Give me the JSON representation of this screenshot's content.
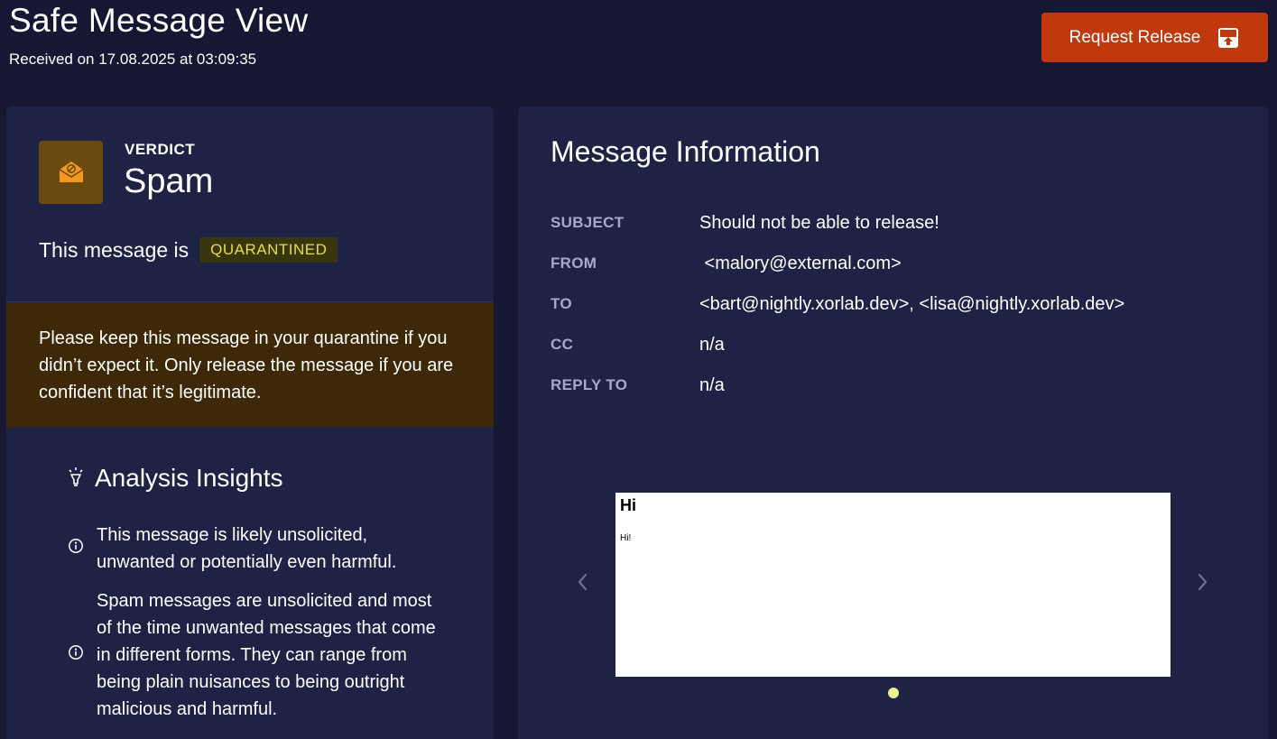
{
  "header": {
    "title": "Safe Message View",
    "received": "Received on 17.08.2025 at 03:09:35",
    "request_release_label": "Request Release"
  },
  "verdict": {
    "label": "VERDICT",
    "value": "Spam",
    "icon": "spam-envelope-icon",
    "status_prefix": "This message is",
    "status_badge": "QUARANTINED"
  },
  "warning": {
    "text": "Please keep this message in your quarantine if you didn’t expect it. Only release the message if you are confident that it’s legitimate."
  },
  "insights": {
    "title": "Analysis Insights",
    "items": [
      "This message is likely unsolicited, unwanted or potentially even harmful.",
      "Spam messages are unsolicited and most of the time unwanted messages that come in different forms. They can range from being plain nuisances to being outright malicious and harmful."
    ]
  },
  "message_info": {
    "title": "Message Information",
    "fields": [
      {
        "label": "SUBJECT",
        "value": "Should not be able to release!"
      },
      {
        "label": "FROM",
        "value": " <malory@external.com>"
      },
      {
        "label": "TO",
        "value": "<bart@nightly.xorlab.dev>, <lisa@nightly.xorlab.dev>"
      },
      {
        "label": "CC",
        "value": "n/a"
      },
      {
        "label": "REPLY TO",
        "value": "n/a"
      }
    ]
  },
  "preview": {
    "heading": "Hi",
    "body": "Hi!",
    "page_count": 1,
    "current_page": 1
  },
  "colors": {
    "background": "#181733",
    "card": "#1e2245",
    "accent_button": "#c0390c",
    "warning_bg": "#3d2908",
    "badge_text": "#e8dc4a",
    "active_dot": "#eef39a"
  }
}
